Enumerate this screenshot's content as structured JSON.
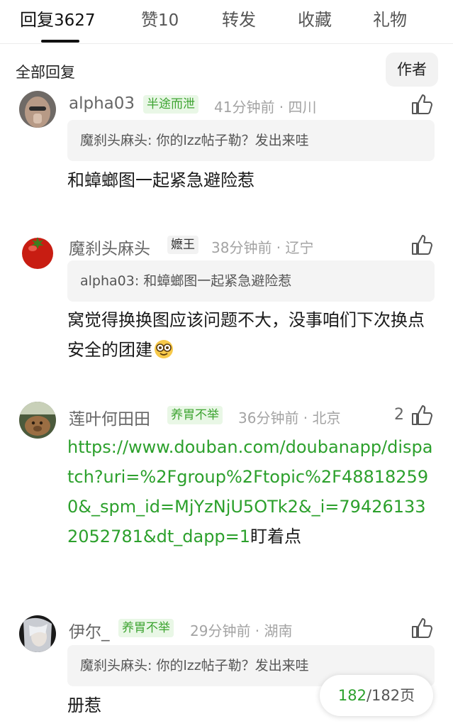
{
  "tabs": [
    {
      "label": "回复",
      "count": "3627",
      "active": true
    },
    {
      "label": "赞",
      "count": "10",
      "active": false
    },
    {
      "label": "转发",
      "count": "",
      "active": false
    },
    {
      "label": "收藏",
      "count": "",
      "active": false
    },
    {
      "label": "礼物",
      "count": "",
      "active": false
    }
  ],
  "filter": {
    "label": "全部回复",
    "author_button": "作者"
  },
  "comments": [
    {
      "author": "alpha03",
      "badge": "半途而泄",
      "time": "41分钟前",
      "location": "四川",
      "like_count": "",
      "quote": "魔刹头麻头: 你的lzz帖子勒？发出来哇",
      "text": "和蟑螂图一起紧急避险惹"
    },
    {
      "author": "魔刹头麻头",
      "badge": "嬷王",
      "time": "38分钟前",
      "location": "辽宁",
      "like_count": "",
      "quote": "alpha03: 和蟑螂图一起紧急避险惹",
      "text": "窝觉得换换图应该问题不大，没事咱们下次换点安全的团建"
    },
    {
      "author": "莲叶何田田",
      "badge": "养胃不举",
      "time": "36分钟前",
      "location": "北京",
      "like_count": "2",
      "quote": "",
      "link": "https://www.douban.com/doubanapp/dispatch?uri=%2Fgroup%2Ftopic%2F488182590&_spm_id=MjYzNjU5OTk2&_i=794261332052781&dt_dapp=1",
      "text": "盯着点"
    },
    {
      "author": "伊尔_",
      "badge": "养胃不举",
      "time": "29分钟前",
      "location": "湖南",
      "like_count": "",
      "quote": "魔刹头麻头: 你的lzz帖子勒？发出来哇",
      "text": "册惹"
    }
  ],
  "pager": {
    "current": "182",
    "total": "/182页"
  },
  "colors": {
    "accent_green": "#2ca02c",
    "badge_green_bg": "#e9f7e6",
    "meta_gray": "#a3a3a3"
  }
}
